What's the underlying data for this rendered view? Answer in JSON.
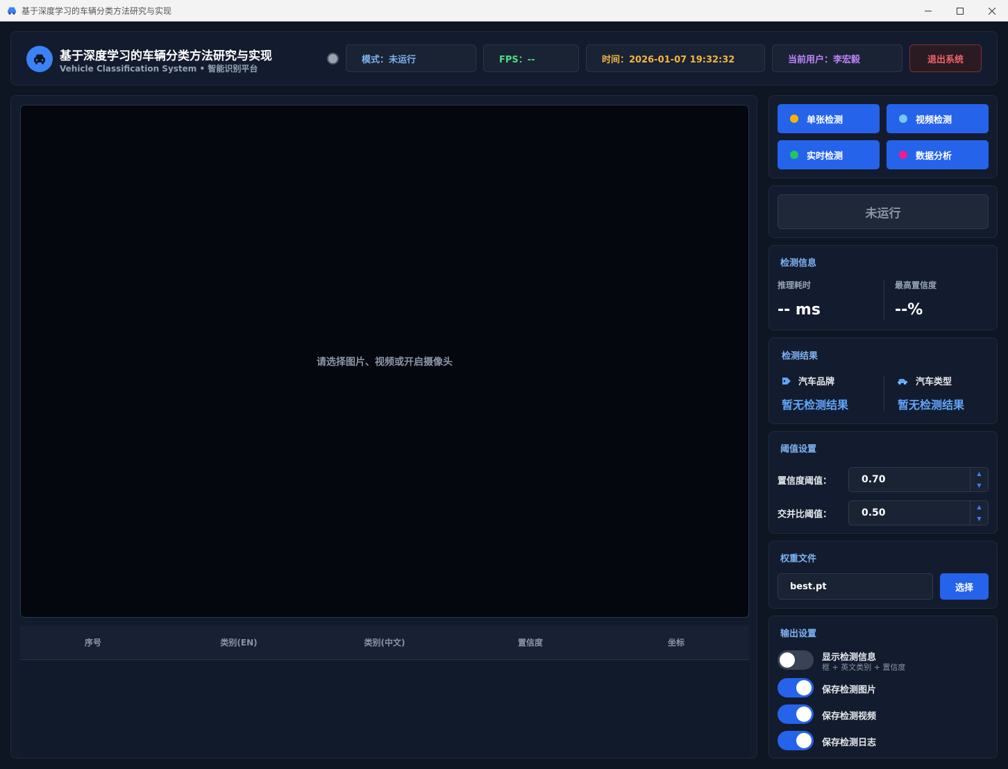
{
  "window": {
    "title": "基于深度学习的车辆分类方法研究与实现"
  },
  "header": {
    "title": "基于深度学习的车辆分类方法研究与实现",
    "subtitle": "Vehicle Classification System • 智能识别平台",
    "mode": "模式：未运行",
    "fps": "FPS：--",
    "time": "时间：2026-01-07 19:32:32",
    "user": "当前用户：李宏毅",
    "logout": "退出系统"
  },
  "viewport": {
    "placeholder": "请选择图片、视频或开启摄像头"
  },
  "table": {
    "columns": [
      "序号",
      "类别(EN)",
      "类别(中文)",
      "置信度",
      "坐标"
    ],
    "rows": []
  },
  "modes": [
    {
      "label": "单张检测",
      "dot_color": "#f5b400"
    },
    {
      "label": "视频检测",
      "dot_color": "#7cc4fa"
    },
    {
      "label": "实时检测",
      "dot_color": "#22c55e"
    },
    {
      "label": "数据分析",
      "dot_color": "#ec1e8c"
    }
  ],
  "run_button": "未运行",
  "detect_info": {
    "title": "检测信息",
    "latency_label": "推理耗时",
    "latency_value": "-- ms",
    "confidence_label": "最高置信度",
    "confidence_value": "--%"
  },
  "detect_result": {
    "title": "检测结果",
    "brand_label": "汽车品牌",
    "brand_value": "暂无检测结果",
    "type_label": "汽车类型",
    "type_value": "暂无检测结果"
  },
  "threshold": {
    "title": "阈值设置",
    "conf_label": "置信度阈值：",
    "conf_value": "0.70",
    "iou_label": "交并比阈值：",
    "iou_value": "0.50"
  },
  "weights": {
    "title": "权重文件",
    "file": "best.pt",
    "choose": "选择"
  },
  "output": {
    "title": "输出设置",
    "items": [
      {
        "label": "显示检测信息",
        "sub": "框 + 英文类别 + 置信度",
        "on": false
      },
      {
        "label": "保存检测图片",
        "on": true
      },
      {
        "label": "保存检测视频",
        "on": true
      },
      {
        "label": "保存检测日志",
        "on": true
      }
    ]
  },
  "colors": {
    "accent": "#2563eb",
    "panel": "#131c2e",
    "background": "#0f1623"
  }
}
